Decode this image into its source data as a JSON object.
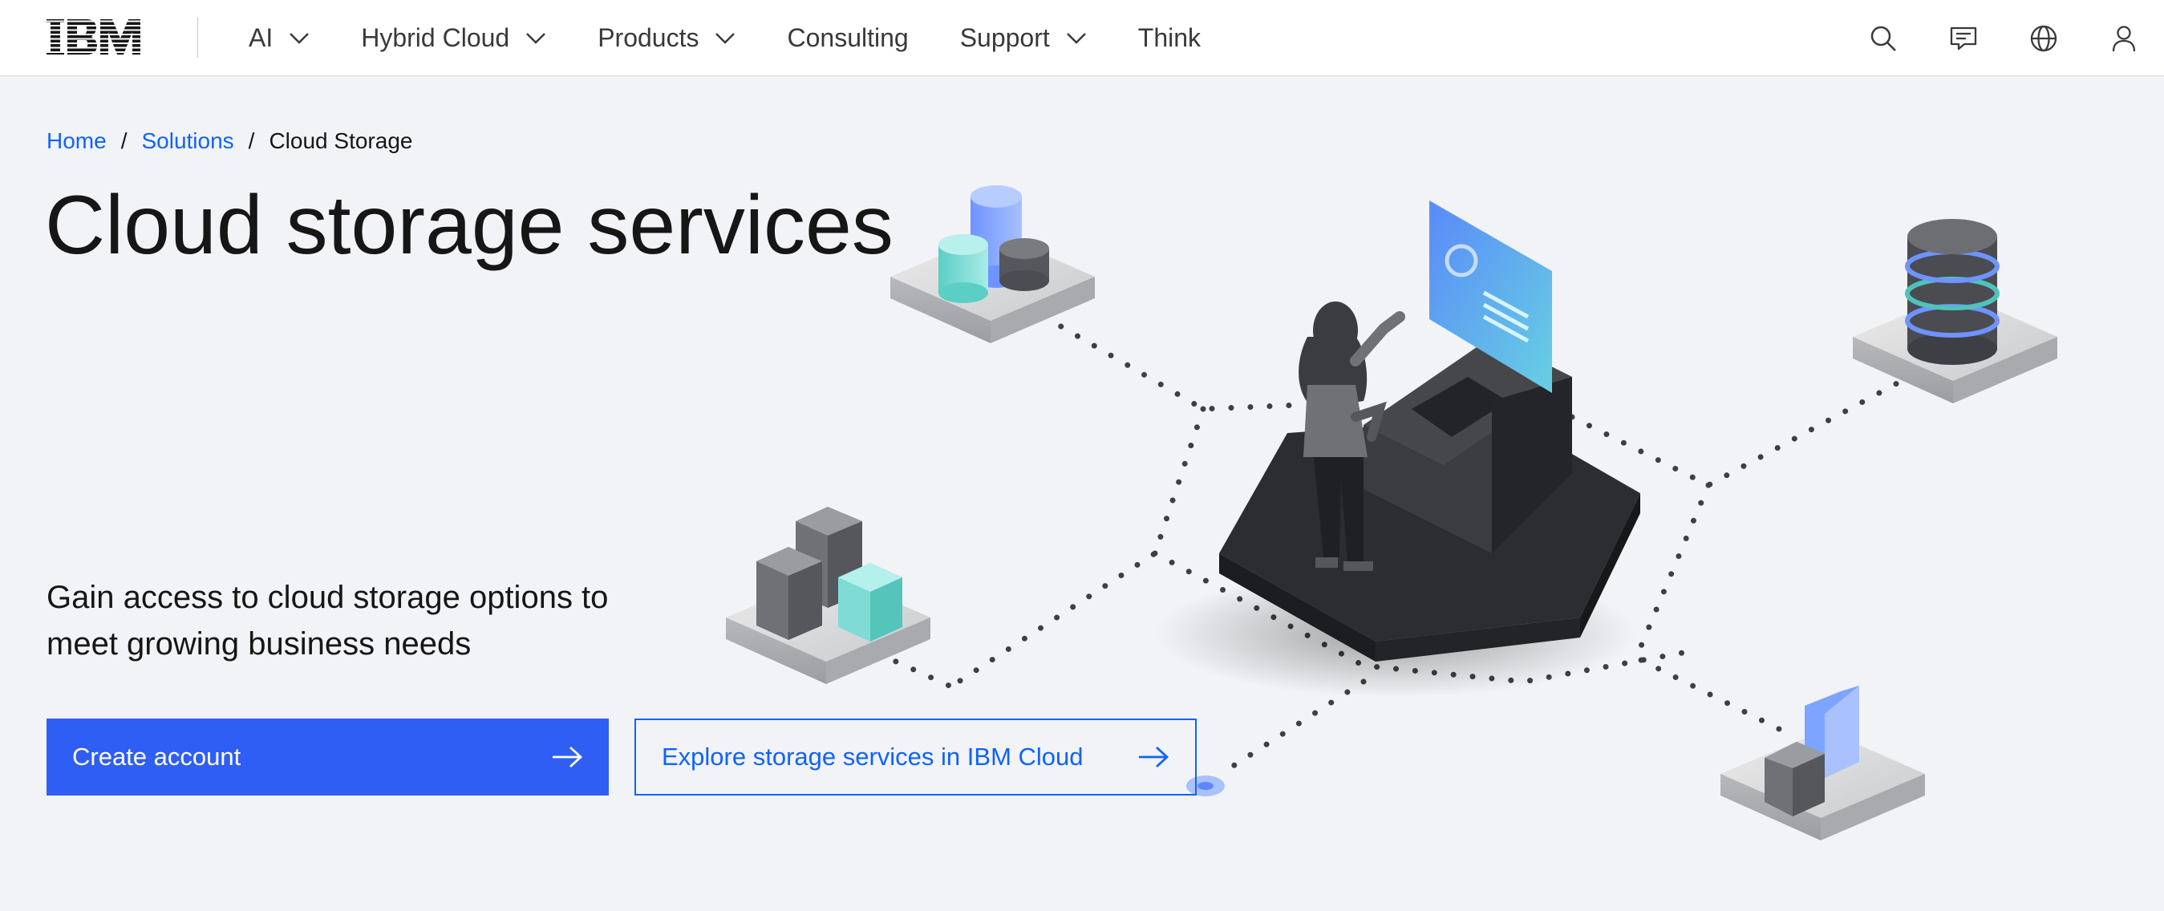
{
  "brand": {
    "logo_text": "IBM"
  },
  "nav": {
    "items": [
      {
        "label": "AI",
        "has_dropdown": true
      },
      {
        "label": "Hybrid Cloud",
        "has_dropdown": true
      },
      {
        "label": "Products",
        "has_dropdown": true
      },
      {
        "label": "Consulting",
        "has_dropdown": false
      },
      {
        "label": "Support",
        "has_dropdown": true
      },
      {
        "label": "Think",
        "has_dropdown": false
      }
    ],
    "tools": [
      "search-icon",
      "chat-icon",
      "globe-icon",
      "user-icon"
    ]
  },
  "breadcrumb": {
    "home": "Home",
    "solutions": "Solutions",
    "current": "Cloud Storage",
    "separator": "/"
  },
  "hero": {
    "title": "Cloud storage services",
    "subtitle": "Gain access to cloud storage options to meet growing business needs",
    "primary_button": "Create account",
    "secondary_button": "Explore storage services in IBM Cloud"
  },
  "colors": {
    "primary": "#2f5ef5",
    "link": "#0f62fe",
    "background": "#f2f3f6",
    "text": "#161616"
  }
}
